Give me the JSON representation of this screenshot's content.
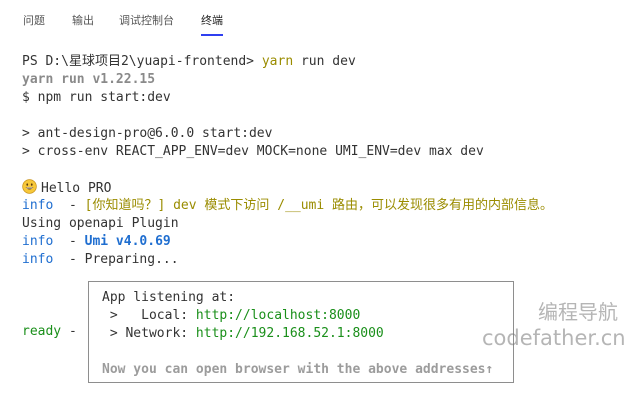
{
  "tabs": [
    {
      "label": "问题"
    },
    {
      "label": "输出"
    },
    {
      "label": "调试控制台"
    },
    {
      "label": "终端"
    }
  ],
  "terminal": {
    "prompt": "PS D:\\星球项目2\\yuapi-frontend> ",
    "command_yarn": "yarn",
    "command_rest": " run dev",
    "yarn_version": "yarn run v1.22.15",
    "npm_cmd": "$ npm run start:dev",
    "script_line": "> ant-design-pro@6.0.0 start:dev",
    "cross_env_line": "> cross-env REACT_APP_ENV=dev MOCK=none UMI_ENV=dev max dev",
    "hello": "Hello PRO",
    "info_label": "info",
    "info_sep": "  - ",
    "tip": "[你知道吗？] dev 模式下访问 /__umi 路由，可以发现很多有用的内部信息。",
    "openapi": "Using openapi Plugin",
    "umi_version": "Umi v4.0.69",
    "preparing": "Preparing...",
    "ready_label": "ready",
    "ready_sep": " -"
  },
  "info_box": {
    "listening": "App listening at:",
    "local_label": " >   Local: ",
    "local_url": "http://localhost:8000",
    "network_label": " > Network: ",
    "network_url": "http://192.168.52.1:8000",
    "note": "Now you can open browser with the above addresses↑"
  },
  "watermark": {
    "cn": "编程导航",
    "en": "codefather.cn"
  },
  "colors": {
    "accent_tab": "#2f3ff0",
    "info_blue": "#1f6ed0",
    "ready_green": "#1a8f1a",
    "yellow": "#9a8c00"
  }
}
